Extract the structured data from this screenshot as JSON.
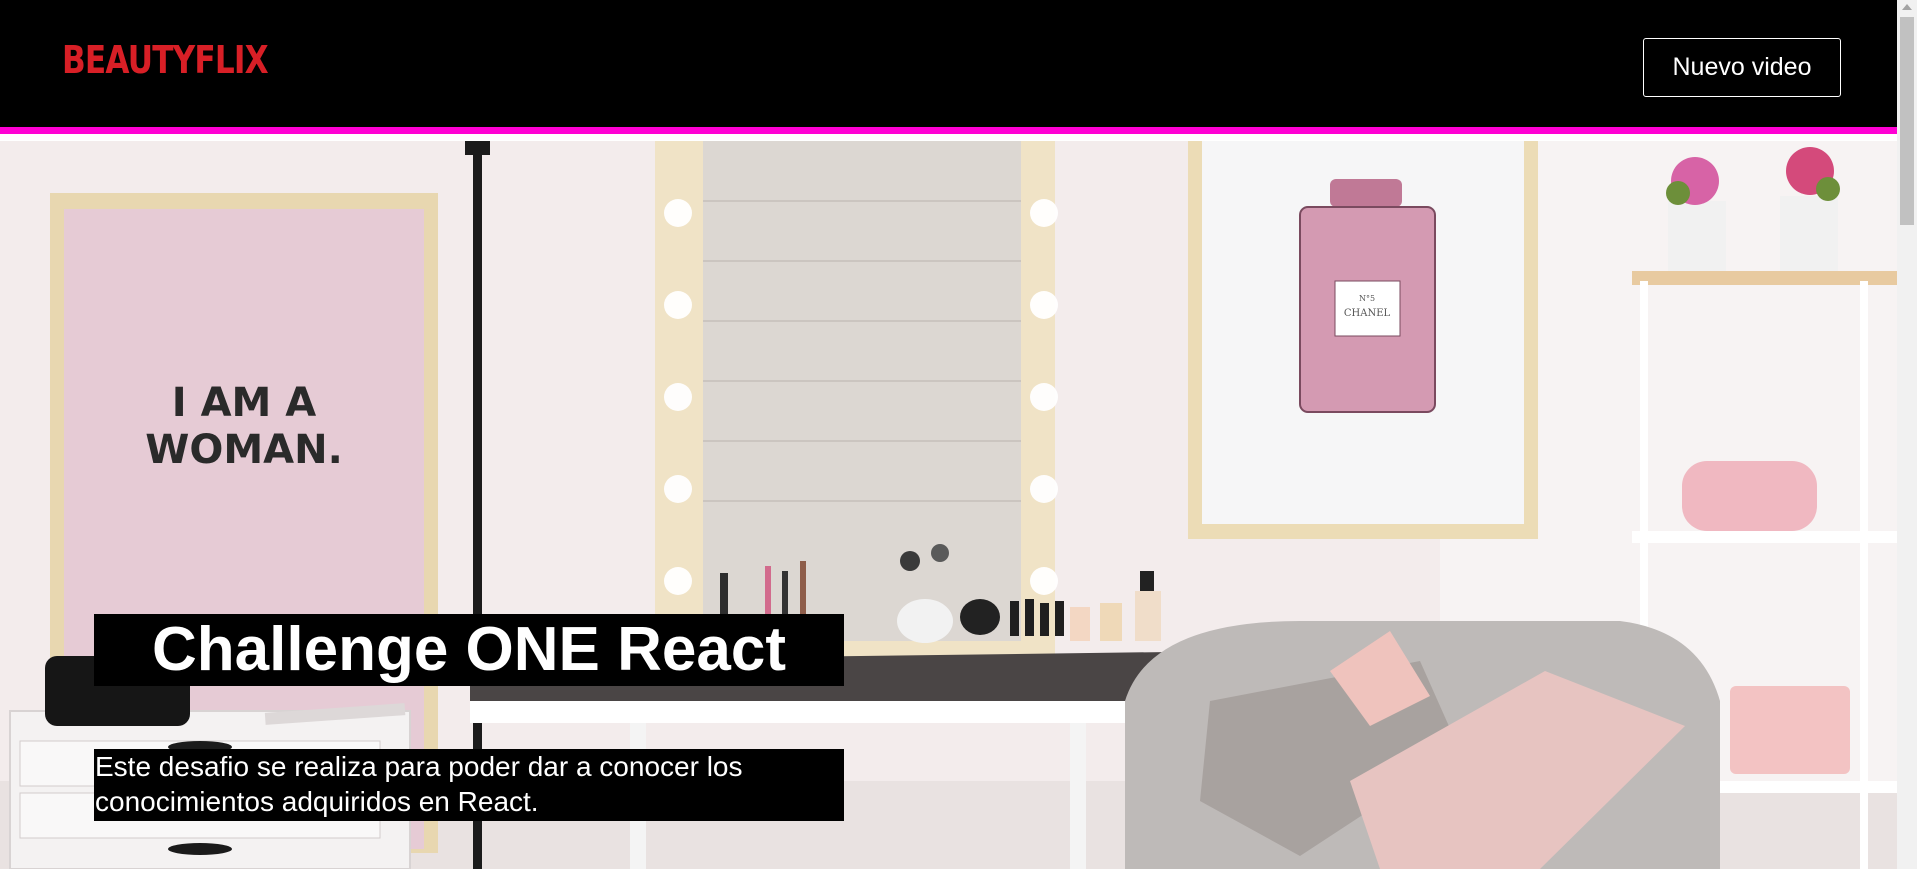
{
  "header": {
    "logo_text": "BEAUTYFLIX",
    "new_video_label": "Nuevo video"
  },
  "banner": {
    "title": "Challenge ONE React",
    "description": "Este desafio se realiza para poder dar a conocer los conocimientos adquiridos en React.",
    "poster_text_line1": "I AM A",
    "poster_text_line2": "WOMAN.",
    "perfume_label_line1": "N°5",
    "perfume_label_line2": "CHANEL"
  },
  "colors": {
    "header_bg": "#000000",
    "accent_border": "#ff00d4",
    "logo": "#d81f26"
  }
}
